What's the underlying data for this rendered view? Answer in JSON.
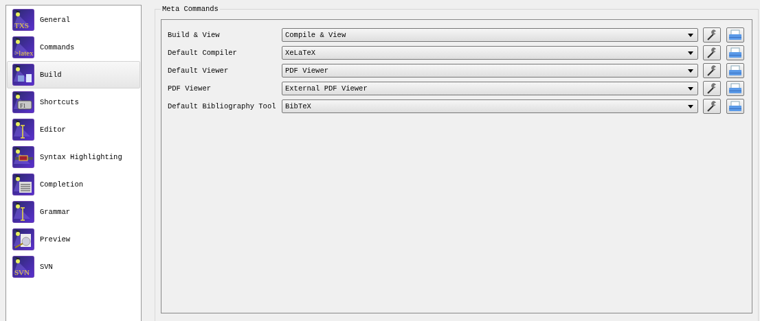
{
  "sidebar": {
    "items": [
      {
        "label": "General",
        "icon_text": "TXS",
        "kind": "text",
        "selected": false
      },
      {
        "label": "Commands",
        "icon_text": ">latex",
        "kind": "text",
        "selected": false
      },
      {
        "label": "Build",
        "kind": "build",
        "selected": true
      },
      {
        "label": "Shortcuts",
        "icon_text": "F1",
        "kind": "key",
        "selected": false
      },
      {
        "label": "Editor",
        "kind": "cursor",
        "selected": false
      },
      {
        "label": "Syntax Highlighting",
        "kind": "highlight",
        "selected": false
      },
      {
        "label": "Completion",
        "kind": "list",
        "selected": false
      },
      {
        "label": "Grammar",
        "kind": "cursor",
        "selected": false
      },
      {
        "label": "Preview",
        "kind": "magnifier",
        "selected": false
      },
      {
        "label": "SVN",
        "icon_text": "SVN",
        "kind": "text",
        "selected": false
      }
    ]
  },
  "group": {
    "title": "Meta Commands",
    "rows": [
      {
        "label": "Build & View",
        "value": "Compile & View"
      },
      {
        "label": "Default Compiler",
        "value": "XeLaTeX"
      },
      {
        "label": "Default Viewer",
        "value": "PDF Viewer"
      },
      {
        "label": "PDF Viewer",
        "value": "External PDF Viewer"
      },
      {
        "label": "Default Bibliography Tool",
        "value": "BibTeX"
      }
    ]
  }
}
